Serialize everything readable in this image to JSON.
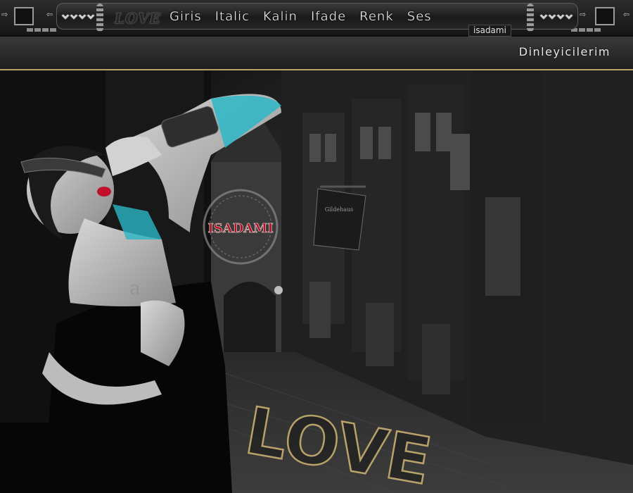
{
  "menu": {
    "logo_text": "LOVE",
    "items": [
      {
        "label": "Giris"
      },
      {
        "label": "Italic"
      },
      {
        "label": "Kalin"
      },
      {
        "label": "Ifade"
      },
      {
        "label": "Renk"
      },
      {
        "label": "Ses"
      }
    ],
    "user_tag": "isadami"
  },
  "subbar": {
    "listeners_label": "Dinleyicilerim"
  },
  "scene": {
    "stamp_text": "ISADAMI",
    "watermark_letter": "a",
    "big_word": "LOVE",
    "sign_text": "Gildehaus"
  },
  "colors": {
    "accent_gold": "#b9a26a",
    "lip_red": "#c0102a",
    "cyan_glow": "#2bb7c6"
  },
  "icons": [
    "left-arrow-icon",
    "right-arrow-icon",
    "heart-chain-icon",
    "chain-icon"
  ]
}
